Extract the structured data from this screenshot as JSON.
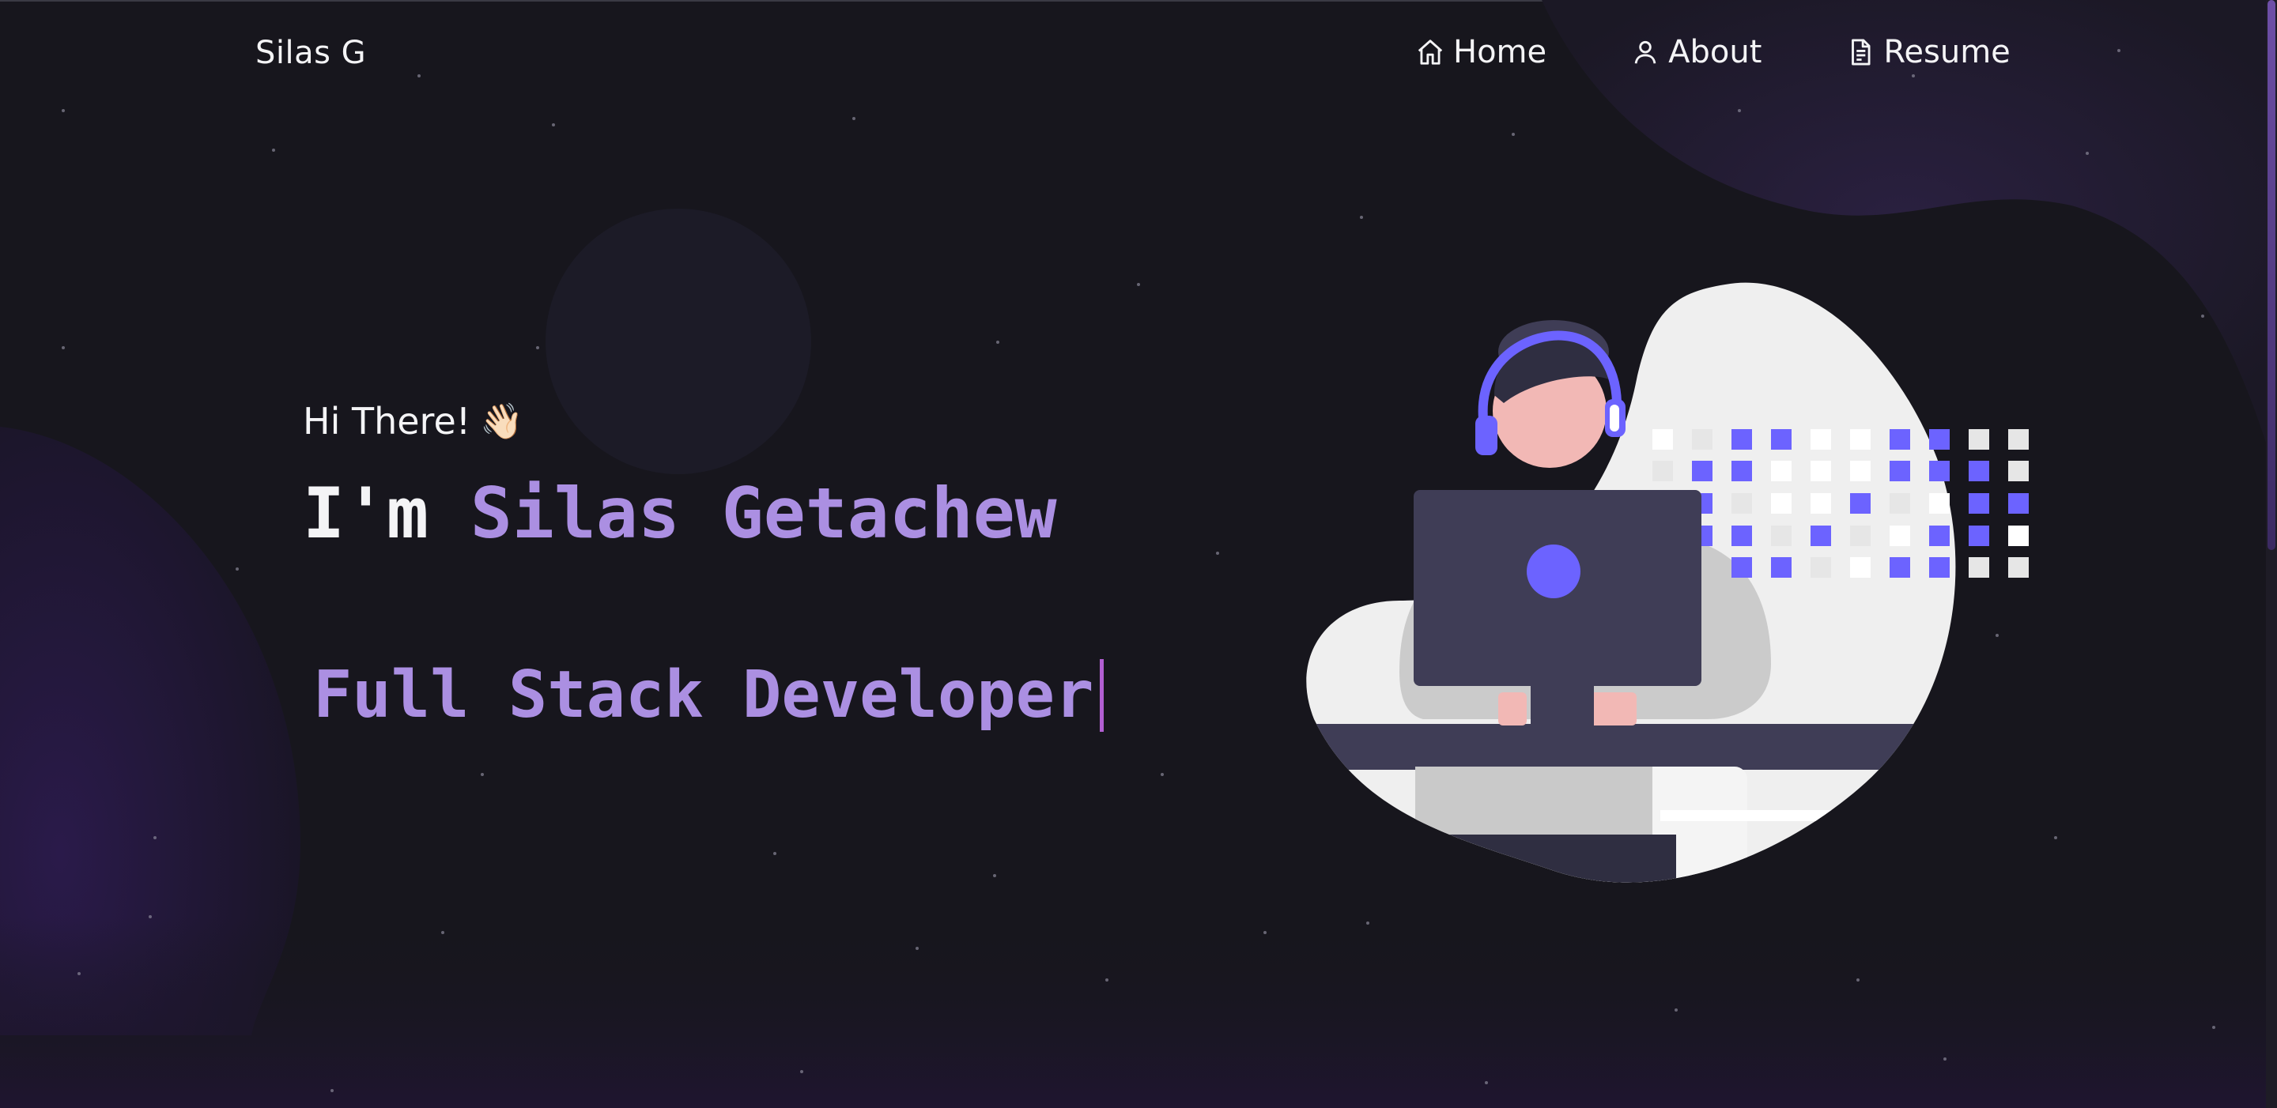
{
  "nav": {
    "brand": "Silas G",
    "items": [
      {
        "label": "Home",
        "icon": "home-icon"
      },
      {
        "label": "About",
        "icon": "user-icon"
      },
      {
        "label": "Resume",
        "icon": "document-icon"
      }
    ]
  },
  "hero": {
    "greeting": "Hi There!",
    "wave": "👋🏻",
    "name_prefix": "I'm ",
    "name": "Silas Getachew",
    "role": "Full Stack Developer"
  },
  "colors": {
    "background": "#17161d",
    "accent": "#ab8fe2",
    "illustration_primary": "#6c63ff",
    "cursor": "#b25fd2"
  }
}
